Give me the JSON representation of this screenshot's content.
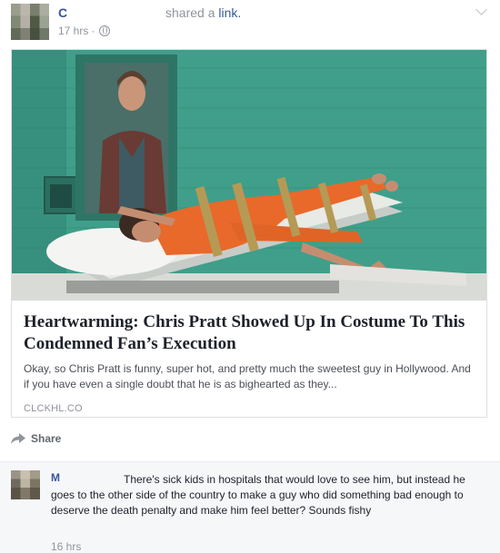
{
  "post": {
    "author": "C",
    "action": "shared a",
    "action_link": "link.",
    "time": "17 hrs",
    "separator": "·",
    "privacy_icon": "globe-icon",
    "menu_icon": "chevron-down-icon"
  },
  "link_card": {
    "title": "Heartwarming: Chris Pratt Showed Up In Costume To This Condemned Fan’s Execution",
    "description": "Okay, so Chris Pratt is funny, super hot, and pretty much the sweetest guy in Hollywood. And if you have even a single doubt that he is as bighearted as they...",
    "domain": "CLCKHL.CO"
  },
  "actions": {
    "share_label": "Share",
    "share_icon": "share-arrow-icon"
  },
  "comment": {
    "author": "M",
    "text": "There's sick kids in hospitals that would love to see him, but instead he goes to the other side of the country to make a guy who did something bad enough to deserve the death penalty and make him feel better? Sounds fishy",
    "time": "16 hrs"
  }
}
